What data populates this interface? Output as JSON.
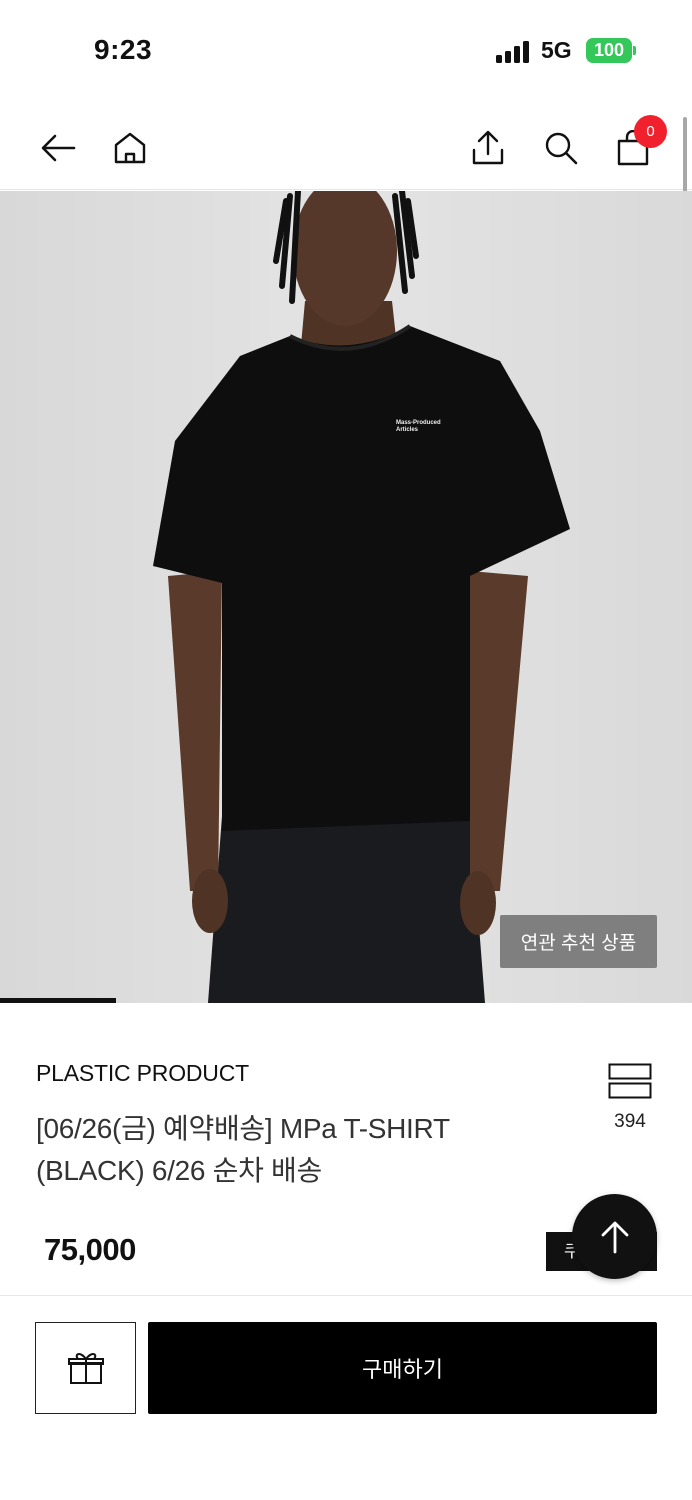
{
  "status_bar": {
    "time": "9:23",
    "network": "5G",
    "battery": "100",
    "battery_color": "#34c759"
  },
  "nav": {
    "icons": [
      "back-arrow-icon",
      "home-icon",
      "share-icon",
      "search-icon",
      "cart-icon"
    ],
    "cart_count": "0",
    "badge_color": "#f0212c"
  },
  "hero": {
    "shirt_print_line1": "Mass-Produced",
    "shirt_print_line2": "Articles",
    "related_button": "연관 추천 상품",
    "slide_progress": 0.167
  },
  "product": {
    "brand": "PLASTIC PRODUCT",
    "title": "[06/26(금) 예약배송]  MPa T-SHIRT (BLACK) 6/26 순차 배송",
    "view_count": "394",
    "price": "75,000",
    "coupon_label": "쿠폰받기"
  },
  "bottom_bar": {
    "gift_icon": "gift-icon",
    "buy_label": "구매하기"
  }
}
